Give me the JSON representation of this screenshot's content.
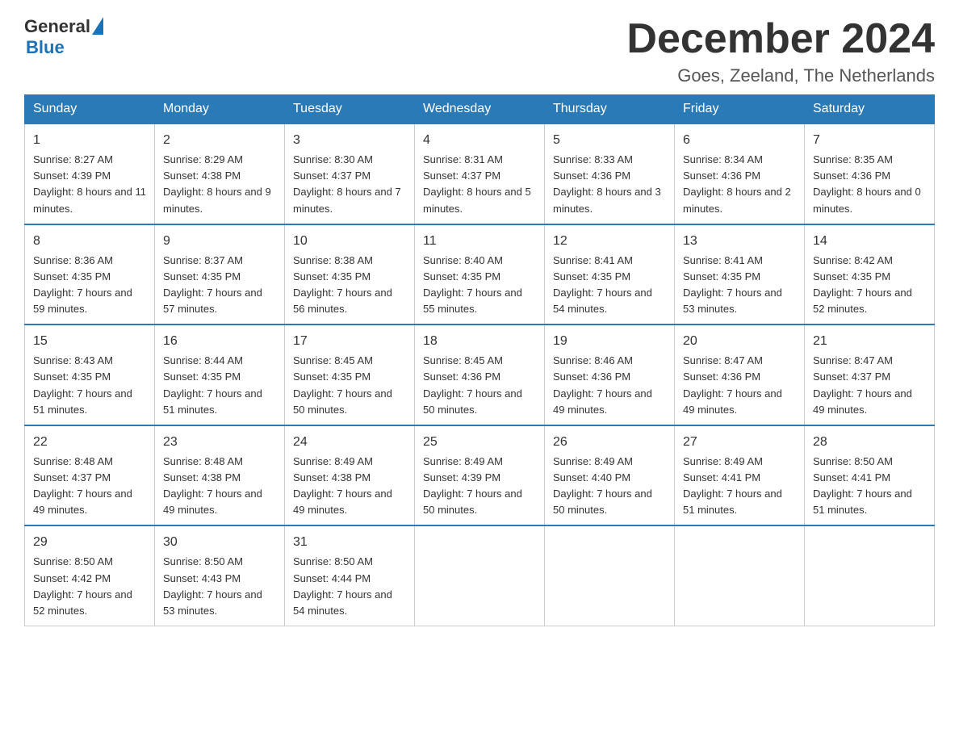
{
  "header": {
    "logo_text1": "General",
    "logo_text2": "Blue",
    "month_title": "December 2024",
    "location": "Goes, Zeeland, The Netherlands"
  },
  "weekdays": [
    "Sunday",
    "Monday",
    "Tuesday",
    "Wednesday",
    "Thursday",
    "Friday",
    "Saturday"
  ],
  "weeks": [
    [
      {
        "day": "1",
        "sunrise": "8:27 AM",
        "sunset": "4:39 PM",
        "daylight": "8 hours and 11 minutes."
      },
      {
        "day": "2",
        "sunrise": "8:29 AM",
        "sunset": "4:38 PM",
        "daylight": "8 hours and 9 minutes."
      },
      {
        "day": "3",
        "sunrise": "8:30 AM",
        "sunset": "4:37 PM",
        "daylight": "8 hours and 7 minutes."
      },
      {
        "day": "4",
        "sunrise": "8:31 AM",
        "sunset": "4:37 PM",
        "daylight": "8 hours and 5 minutes."
      },
      {
        "day": "5",
        "sunrise": "8:33 AM",
        "sunset": "4:36 PM",
        "daylight": "8 hours and 3 minutes."
      },
      {
        "day": "6",
        "sunrise": "8:34 AM",
        "sunset": "4:36 PM",
        "daylight": "8 hours and 2 minutes."
      },
      {
        "day": "7",
        "sunrise": "8:35 AM",
        "sunset": "4:36 PM",
        "daylight": "8 hours and 0 minutes."
      }
    ],
    [
      {
        "day": "8",
        "sunrise": "8:36 AM",
        "sunset": "4:35 PM",
        "daylight": "7 hours and 59 minutes."
      },
      {
        "day": "9",
        "sunrise": "8:37 AM",
        "sunset": "4:35 PM",
        "daylight": "7 hours and 57 minutes."
      },
      {
        "day": "10",
        "sunrise": "8:38 AM",
        "sunset": "4:35 PM",
        "daylight": "7 hours and 56 minutes."
      },
      {
        "day": "11",
        "sunrise": "8:40 AM",
        "sunset": "4:35 PM",
        "daylight": "7 hours and 55 minutes."
      },
      {
        "day": "12",
        "sunrise": "8:41 AM",
        "sunset": "4:35 PM",
        "daylight": "7 hours and 54 minutes."
      },
      {
        "day": "13",
        "sunrise": "8:41 AM",
        "sunset": "4:35 PM",
        "daylight": "7 hours and 53 minutes."
      },
      {
        "day": "14",
        "sunrise": "8:42 AM",
        "sunset": "4:35 PM",
        "daylight": "7 hours and 52 minutes."
      }
    ],
    [
      {
        "day": "15",
        "sunrise": "8:43 AM",
        "sunset": "4:35 PM",
        "daylight": "7 hours and 51 minutes."
      },
      {
        "day": "16",
        "sunrise": "8:44 AM",
        "sunset": "4:35 PM",
        "daylight": "7 hours and 51 minutes."
      },
      {
        "day": "17",
        "sunrise": "8:45 AM",
        "sunset": "4:35 PM",
        "daylight": "7 hours and 50 minutes."
      },
      {
        "day": "18",
        "sunrise": "8:45 AM",
        "sunset": "4:36 PM",
        "daylight": "7 hours and 50 minutes."
      },
      {
        "day": "19",
        "sunrise": "8:46 AM",
        "sunset": "4:36 PM",
        "daylight": "7 hours and 49 minutes."
      },
      {
        "day": "20",
        "sunrise": "8:47 AM",
        "sunset": "4:36 PM",
        "daylight": "7 hours and 49 minutes."
      },
      {
        "day": "21",
        "sunrise": "8:47 AM",
        "sunset": "4:37 PM",
        "daylight": "7 hours and 49 minutes."
      }
    ],
    [
      {
        "day": "22",
        "sunrise": "8:48 AM",
        "sunset": "4:37 PM",
        "daylight": "7 hours and 49 minutes."
      },
      {
        "day": "23",
        "sunrise": "8:48 AM",
        "sunset": "4:38 PM",
        "daylight": "7 hours and 49 minutes."
      },
      {
        "day": "24",
        "sunrise": "8:49 AM",
        "sunset": "4:38 PM",
        "daylight": "7 hours and 49 minutes."
      },
      {
        "day": "25",
        "sunrise": "8:49 AM",
        "sunset": "4:39 PM",
        "daylight": "7 hours and 50 minutes."
      },
      {
        "day": "26",
        "sunrise": "8:49 AM",
        "sunset": "4:40 PM",
        "daylight": "7 hours and 50 minutes."
      },
      {
        "day": "27",
        "sunrise": "8:49 AM",
        "sunset": "4:41 PM",
        "daylight": "7 hours and 51 minutes."
      },
      {
        "day": "28",
        "sunrise": "8:50 AM",
        "sunset": "4:41 PM",
        "daylight": "7 hours and 51 minutes."
      }
    ],
    [
      {
        "day": "29",
        "sunrise": "8:50 AM",
        "sunset": "4:42 PM",
        "daylight": "7 hours and 52 minutes."
      },
      {
        "day": "30",
        "sunrise": "8:50 AM",
        "sunset": "4:43 PM",
        "daylight": "7 hours and 53 minutes."
      },
      {
        "day": "31",
        "sunrise": "8:50 AM",
        "sunset": "4:44 PM",
        "daylight": "7 hours and 54 minutes."
      },
      null,
      null,
      null,
      null
    ]
  ]
}
